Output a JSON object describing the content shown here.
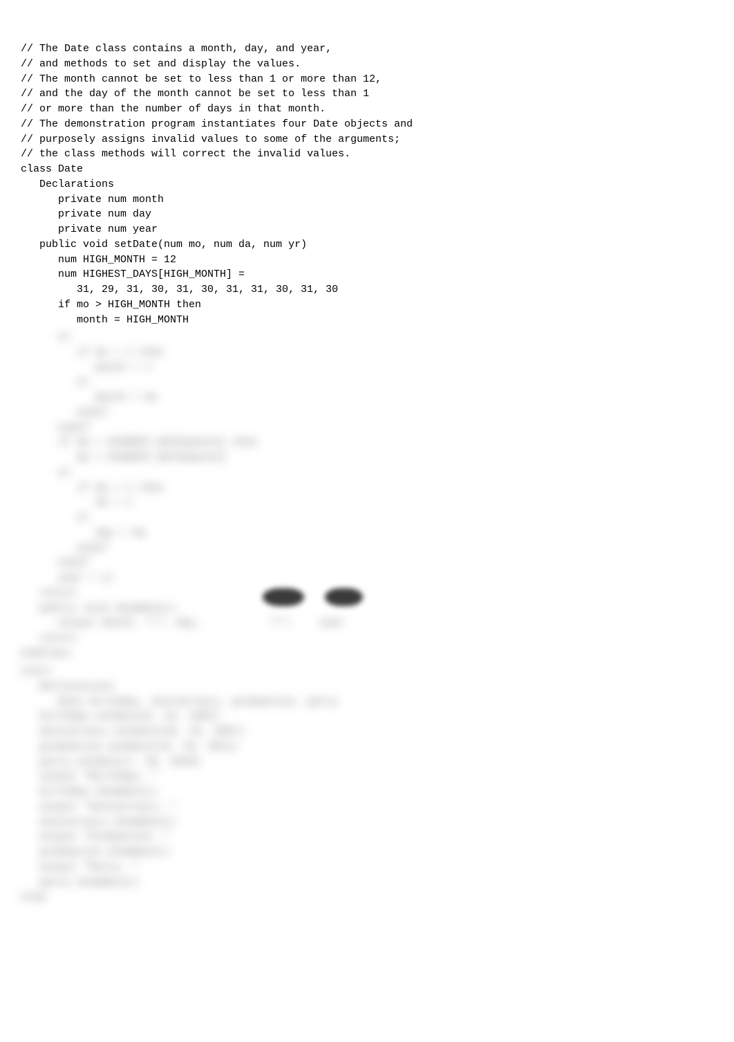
{
  "visible_code": "// The Date class contains a month, day, and year,\n// and methods to set and display the values.\n// The month cannot be set to less than 1 or more than 12,\n// and the day of the month cannot be set to less than 1\n// or more than the number of days in that month.\n// The demonstration program instantiates four Date objects and\n// purposely assigns invalid values to some of the arguments;\n// the class methods will correct the invalid values.\nclass Date\n   Declarations\n      private num month\n      private num day\n      private num year\n   public void setDate(num mo, num da, num yr)\n      num HIGH_MONTH = 12\n      num HIGHEST_DAYS[HIGH_MONTH] =\n         31, 29, 31, 30, 31, 30, 31, 31, 30, 31, 30\n      if mo > HIGH_MONTH then\n         month = HIGH_MONTH",
  "blurred_region_1": "      el\n         if mo < 1 then\n            month = 1\n         el\n            month = mo\n         endif\n      endif\n      if da > HIGHEST_DAYS[month] then\n         da = HIGHEST_DAYS[month]\n      el\n         if da < 1 then\n            da = 1\n         el\n            day = da\n         endif\n      endif\n      year = yr\n   return\n   public void showDate()\n      output month, \"/\", day,           \"/\",    year\n   return\nendClass",
  "blurred_region_2": "start\n   Declarations\n      Date birthday, anniversary, graduation, party\n   birthday.setDate(6, 24, 1982)\n   anniversary.setDate(10, 15, 2007)\n   graduation.setDate(14, 19, 2011)\n   party.setDate(7, 35, 2010)\n   output \"Birthday: \"\n   birthday.showDate()\n   output \"Anniversary: \"\n   anniversary.showDate()\n   output \"Graduation: \"\n   graduation.showDate()\n   output \"Party: \"\n   party.showDate()\nstop"
}
